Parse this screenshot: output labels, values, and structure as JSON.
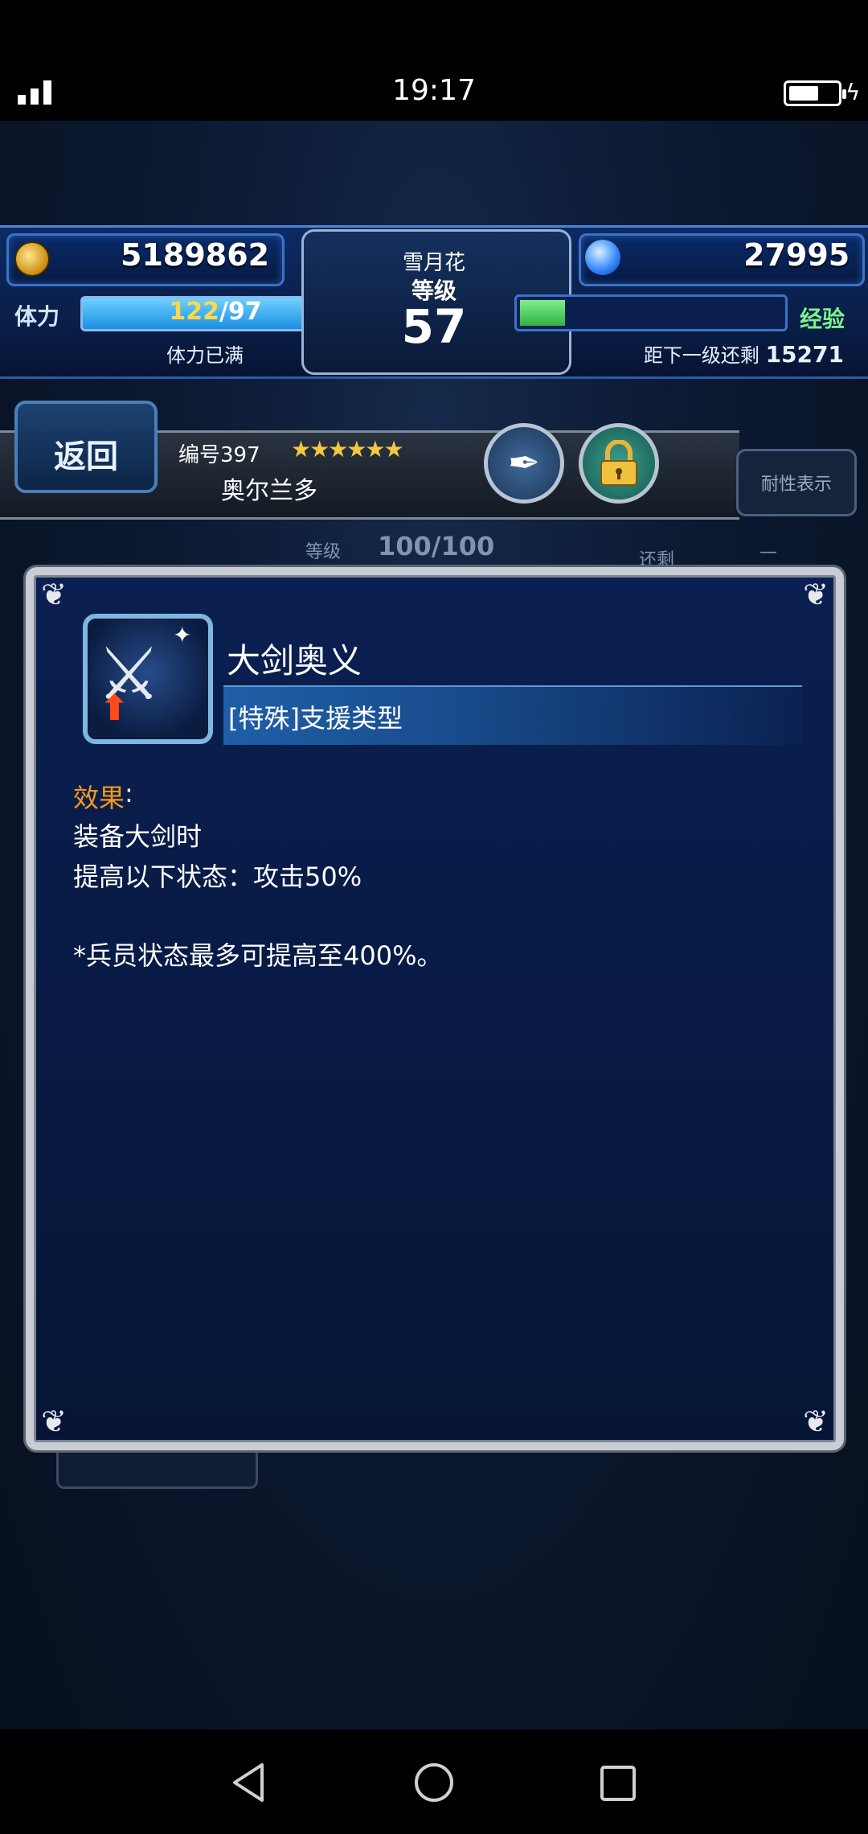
{
  "status_bar": {
    "time": "19:17"
  },
  "hud": {
    "gil": "5189862",
    "gems": "27995",
    "player_name": "雪月花",
    "level_label": "等级",
    "level": "57",
    "stamina_label": "体力",
    "stamina_current": "122",
    "stamina_max": "/97",
    "stamina_status": "体力已满",
    "exp_label": "经验",
    "exp_progress_fraction": 0.17,
    "next_level_label": "距下一级还剩",
    "next_level_value": "15271"
  },
  "unit": {
    "back_label": "返回",
    "number": "编号397",
    "stars": "★★★★★★",
    "name": "奥尔兰多",
    "resist_label": "耐性表示"
  },
  "background_info": {
    "level_label": "等级",
    "level_value": "100/100",
    "remaining_label": "还剩",
    "remaining_value": "—"
  },
  "skill": {
    "name": "大剑奥义",
    "type": "[特殊]支援类型",
    "effect_label": "效果",
    "lines": [
      "装备大剑时",
      "提高以下状态：攻击50%",
      "",
      "*兵员状态最多可提高至400%。"
    ]
  },
  "icons": {
    "gil": "gil-coin-icon",
    "gem": "lapis-crystal-icon",
    "skill": "greatsword-icon",
    "quill": "quill-icon",
    "lock": "lock-icon"
  }
}
